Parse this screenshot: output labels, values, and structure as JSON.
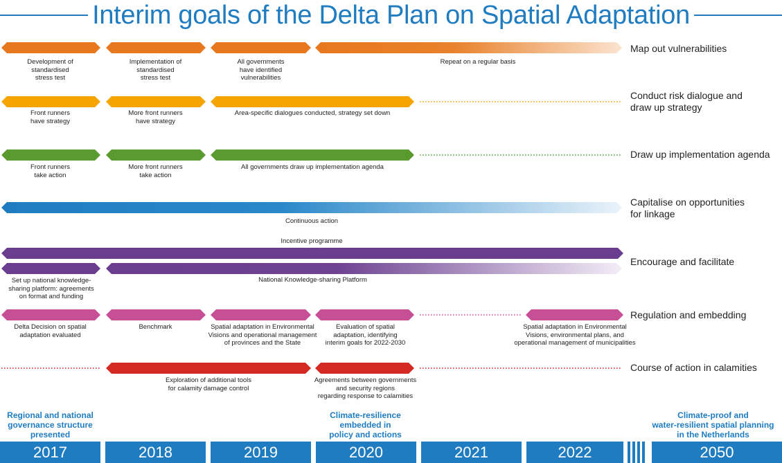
{
  "title": "Interim goals of the Delta Plan on Spatial Adaptation",
  "colors": {
    "title_blue": "#1f7cc1",
    "orange": "#e7781e",
    "yellow": "#f5a400",
    "green": "#5a9a2f",
    "blue": "#1f7cc1",
    "purple": "#6a3d8e",
    "pink": "#c64f95",
    "red": "#d42a23"
  },
  "rows": [
    {
      "goal": [
        "Map out vulnerabilities"
      ],
      "labels": [
        [
          "Development of",
          "standardised",
          "stress test"
        ],
        [
          "Implementation of",
          "standardised",
          "stress test"
        ],
        [
          "All governments",
          "have identified",
          "vulnerabilities"
        ],
        [
          "Repeat on a regular basis"
        ]
      ]
    },
    {
      "goal": [
        "Conduct risk dialogue and",
        "draw up strategy"
      ],
      "labels": [
        [
          "Front runners",
          "have strategy"
        ],
        [
          "More front runners",
          "have strategy"
        ],
        [
          "Area-specific dialogues conducted, strategy set down"
        ]
      ]
    },
    {
      "goal": [
        "Draw up implementation agenda"
      ],
      "labels": [
        [
          "Front runners",
          "take action"
        ],
        [
          "More front runners",
          "take action"
        ],
        [
          "All governments draw up implementation agenda"
        ]
      ]
    },
    {
      "goal": [
        "Capitalise on opportunities",
        "for linkage"
      ],
      "labels": [
        [
          "Continuous action"
        ]
      ]
    },
    {
      "goal": [
        "Encourage and facilitate"
      ],
      "labels": [
        [
          "Incentive programme"
        ],
        [
          "Set up national knowledge-",
          "sharing platform: agreements",
          "on format and funding"
        ],
        [
          "National Knowledge-sharing Platform"
        ]
      ]
    },
    {
      "goal": [
        "Regulation and embedding"
      ],
      "labels": [
        [
          "Delta Decision on spatial",
          "adaptation evaluated"
        ],
        [
          "Benchmark"
        ],
        [
          "Spatial adaptation in Environmental",
          "Visions and operational management",
          "of provinces and the State"
        ],
        [
          "Evaluation of spatial",
          "adaptation, identifying",
          "interim goals for 2022-2030"
        ],
        [
          "Spatial adaptation in Environmental",
          "Visions, environmental plans, and",
          "operational management of municipalities"
        ]
      ]
    },
    {
      "goal": [
        "Course of action in calamities"
      ],
      "labels": [
        [
          "Exploration of additional tools",
          "for calamity damage control"
        ],
        [
          "Agreements between governments",
          "and security regions",
          "regarding response to calamities"
        ]
      ]
    }
  ],
  "milestones": [
    [
      "Regional and national",
      "governance structure",
      "presented"
    ],
    [
      "Climate-resilience",
      "embedded in",
      "policy and actions"
    ],
    [
      "Climate-proof and",
      "water-resilient spatial planning",
      "in the Netherlands"
    ]
  ],
  "years": [
    "2017",
    "2018",
    "2019",
    "2020",
    "2021",
    "2022",
    "2050"
  ]
}
